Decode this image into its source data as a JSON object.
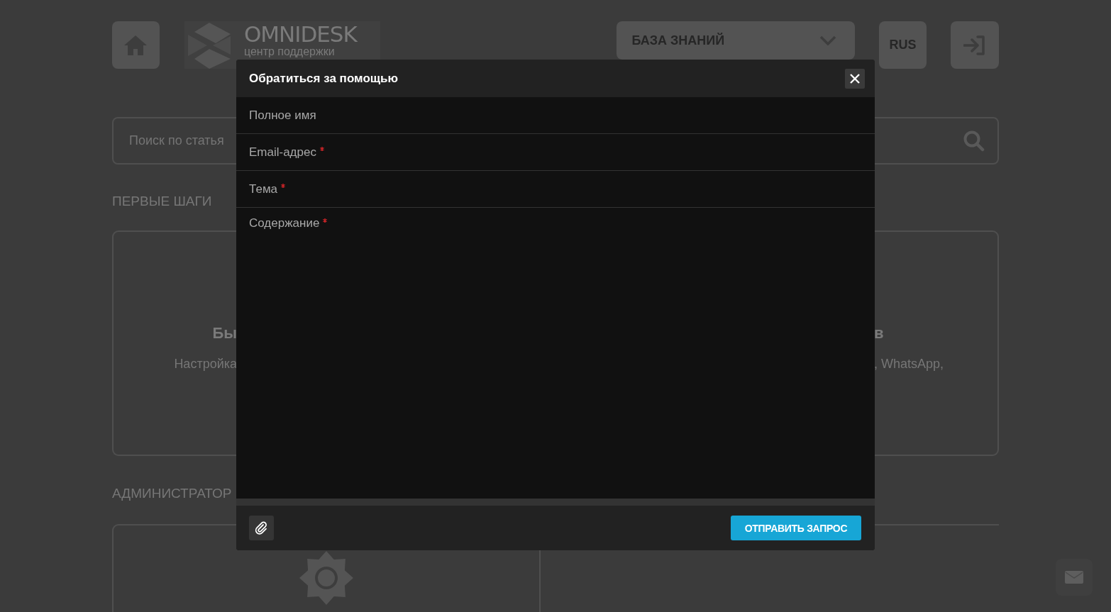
{
  "header": {
    "logo": {
      "name": "OMNIDESK",
      "tagline": "центр поддержки"
    },
    "section_dropdown": {
      "label": "БАЗА ЗНАНИЙ"
    },
    "language_button": {
      "label": "RUS"
    }
  },
  "search": {
    "placeholder": "Поиск по статья"
  },
  "sections": [
    {
      "title": "ПЕРВЫЕ ШАГИ",
      "cards": [
        {
          "title": "Бы",
          "description": "Настройка"
        },
        {
          "title": "в",
          "description": ", WhatsApp,"
        }
      ]
    },
    {
      "title": "АДМИНИСТРАТОР",
      "cards": [
        {
          "kind": "gear"
        },
        {
          "kind": "blank"
        }
      ]
    }
  ],
  "modal": {
    "title": "Обратиться за помощью",
    "fields": [
      {
        "label": "Полное имя",
        "required": false,
        "kind": "line"
      },
      {
        "label": "Email-адрес",
        "required": true,
        "kind": "line"
      },
      {
        "label": "Тема",
        "required": true,
        "kind": "line"
      },
      {
        "label": "Содержание",
        "required": true,
        "kind": "area"
      }
    ],
    "submit": {
      "label": "ОТПРАВИТЬ ЗАПРОС"
    }
  }
}
